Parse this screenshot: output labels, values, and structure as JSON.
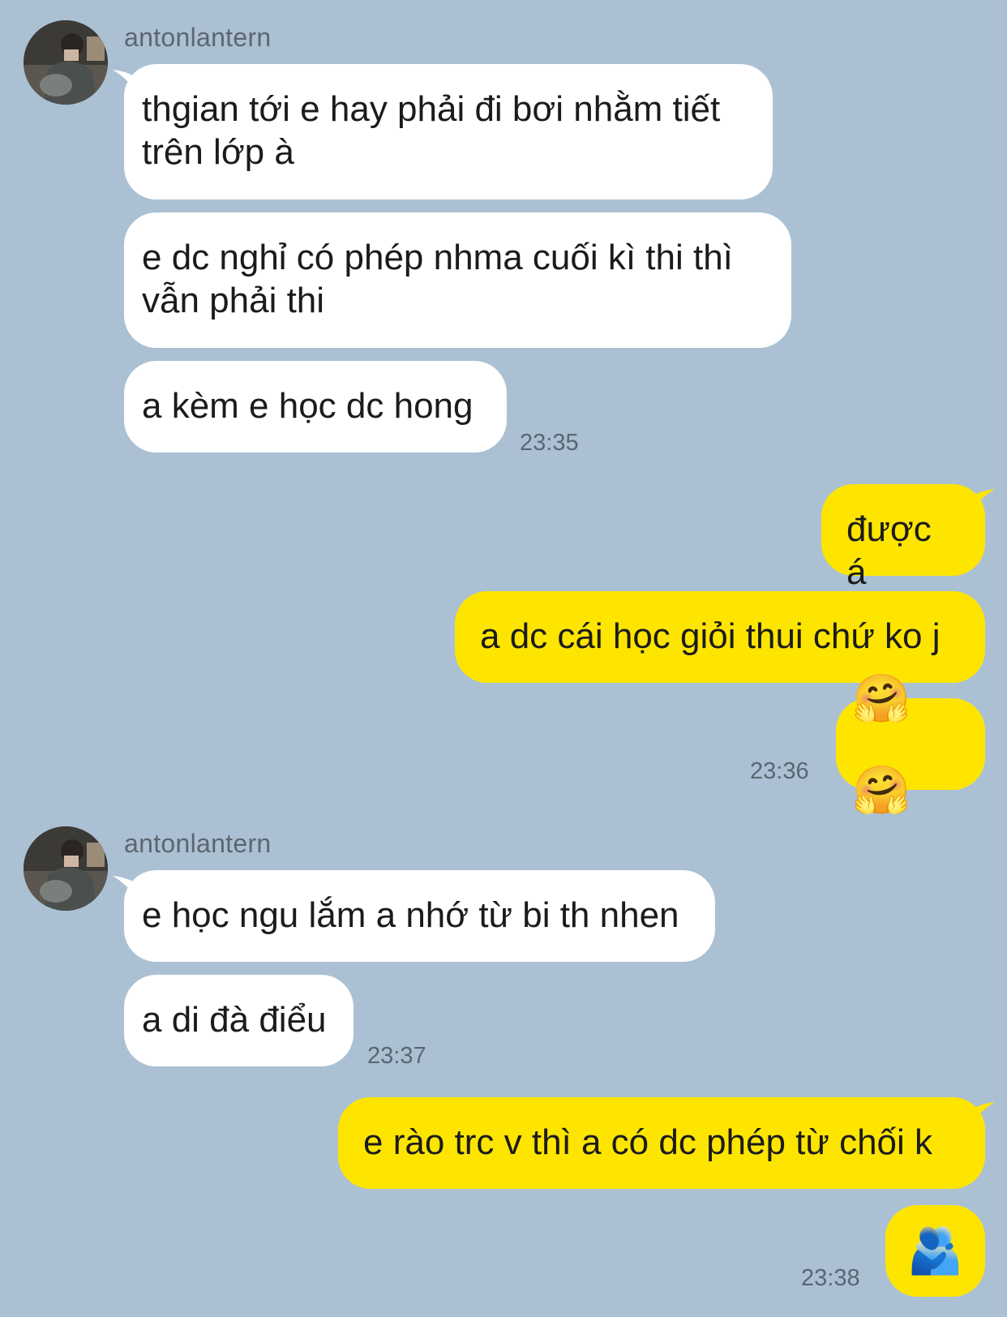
{
  "chat": {
    "groups": [
      {
        "sender": "antonlantern",
        "messages": [
          "thgian tới e hay phải đi bơi nhằm tiết trên lớp à",
          "e dc nghỉ có phép nhma cuối kì thi thì vẫn phải thi",
          "a kèm e học dc hong"
        ],
        "time": "23:35"
      },
      {
        "outgoing": true,
        "messages": [
          "được á",
          "a dc cái học giỏi thui chứ ko j",
          "🤗🤗"
        ],
        "time": "23:36"
      },
      {
        "sender": "antonlantern",
        "messages": [
          "e học ngu lắm a nhớ từ bi th nhen",
          "a di đà điểu"
        ],
        "time": "23:37"
      },
      {
        "outgoing": true,
        "messages": [
          "e rào trc v thì a có dc phép từ chối k",
          "🫂"
        ],
        "time": "23:38"
      }
    ]
  },
  "colors": {
    "background": "#abc1d3",
    "incoming_bubble": "#ffffff",
    "outgoing_bubble": "#fee500"
  }
}
